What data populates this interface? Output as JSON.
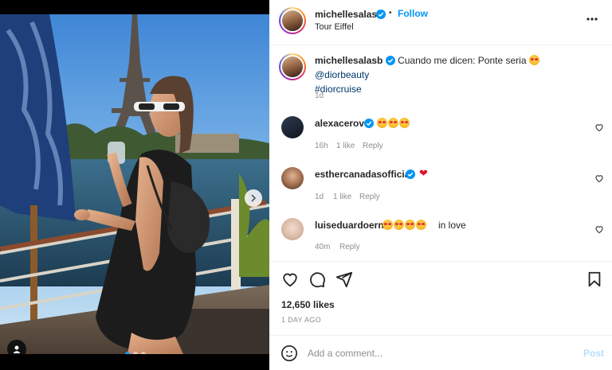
{
  "post": {
    "author": "michellesalasb",
    "follow_label": "Follow",
    "location": "Tour Eiffel",
    "caption_text": "Cuando me dicen: Ponte seria",
    "caption_mention": "@diorbeauty",
    "caption_hashtag": "#diorcruise",
    "caption_age": "1d",
    "likes": "12,650 likes",
    "date": "1 DAY AGO",
    "carousel_slides": 3,
    "carousel_active": 1
  },
  "comments": [
    {
      "user": "alexacerov",
      "emojis": "🤩🤩🤩",
      "age": "16h",
      "likes": "1 like",
      "reply": "Reply"
    },
    {
      "user": "esthercanadasofficial",
      "emojis": "❤️",
      "age": "1d",
      "likes": "1 like",
      "reply": "Reply"
    },
    {
      "user": "luiseduardoern",
      "emojis": "🤩🤩🤩🤩",
      "text": "in love",
      "age": "40m",
      "reply": "Reply"
    }
  ],
  "composer": {
    "placeholder": "Add a comment...",
    "post_label": "Post"
  },
  "colors": {
    "accent": "#0095f6",
    "verified": "#0095f6",
    "muted": "#8e8e8e",
    "heart": "#e0152b"
  },
  "icons": [
    "verified-badge-icon",
    "more-options-icon",
    "heart-icon",
    "comment-icon",
    "share-icon",
    "bookmark-icon",
    "emoji-icon",
    "chevron-right-icon",
    "user-tag-icon"
  ]
}
